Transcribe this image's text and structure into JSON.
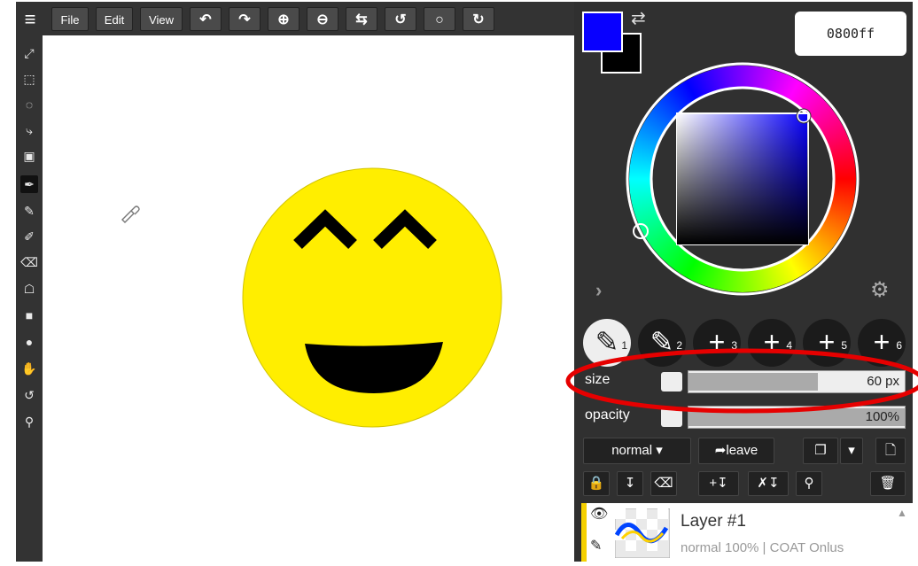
{
  "menu": {
    "hamburger": "≡",
    "file": "File",
    "edit": "Edit",
    "view": "View"
  },
  "toolbar_icons": [
    "undo-icon",
    "redo-icon",
    "zoom-in-icon",
    "zoom-out-icon",
    "flip-icon",
    "rotate-left-icon",
    "reset-icon",
    "rotate-right-icon"
  ],
  "tools": [
    "move-tool-icon",
    "rect-select-icon",
    "ellipse-select-icon",
    "lasso-icon",
    "transform-icon",
    "eyedropper-icon",
    "pencil-icon",
    "brush-icon",
    "eraser-icon",
    "fill-icon",
    "rectangle-icon",
    "ellipse-icon",
    "hand-icon",
    "rotate-icon",
    "zoom-icon"
  ],
  "color": {
    "primary": "#0800ff",
    "secondary": "#000000",
    "hex": "0800ff"
  },
  "brush_slots": [
    "1",
    "2",
    "3",
    "4",
    "5",
    "6"
  ],
  "size": {
    "label": "size",
    "value": "60 px",
    "level": 0.6
  },
  "opacity": {
    "label": "opacity",
    "value": "100%",
    "level": 1.0
  },
  "blend": {
    "mode": "normal",
    "leave": "leave"
  },
  "layer": {
    "name": "Layer #1",
    "info": "normal 100% | COAT Onlus"
  },
  "annotation_color": "#e60000"
}
